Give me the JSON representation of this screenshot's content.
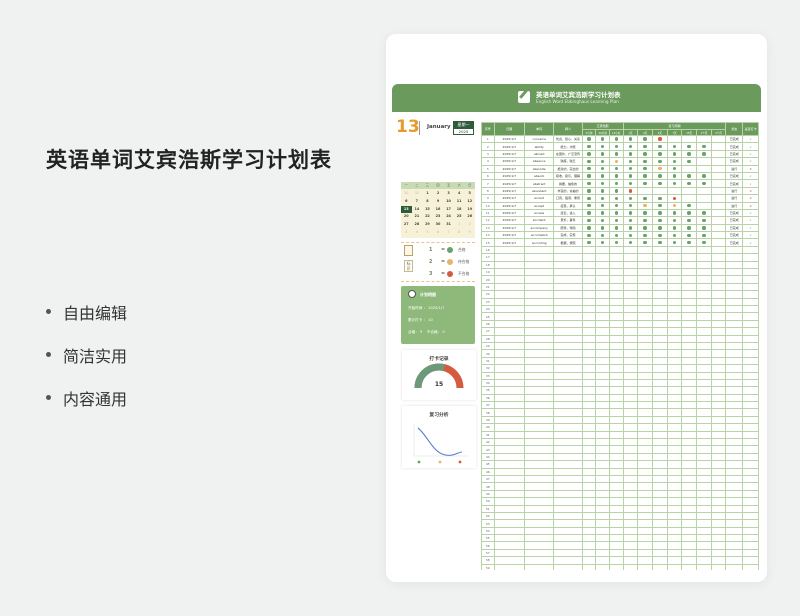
{
  "headline": "英语单词艾宾浩斯学习计划表",
  "features": [
    "自由编辑",
    "简洁实用",
    "内容通用"
  ],
  "colors": {
    "green": "#6aa26a",
    "orange": "#e8b36a",
    "red": "#d65a3e",
    "dark": "#2e5c3a"
  },
  "sheet": {
    "title": "英语单词艾宾浩斯学习计划表",
    "subtitle": "English Word Ebbinghaus Learning Plan",
    "date": {
      "day": "13",
      "month": "January",
      "weekday": "星期一",
      "year": "2025"
    },
    "calendar": {
      "weekdays": [
        "一",
        "二",
        "三",
        "四",
        "五",
        "六",
        "日"
      ],
      "days": [
        "30",
        "31",
        "1",
        "2",
        "3",
        "4",
        "5",
        "6",
        "7",
        "8",
        "9",
        "10",
        "11",
        "12",
        "13",
        "14",
        "15",
        "16",
        "17",
        "18",
        "19",
        "20",
        "21",
        "22",
        "23",
        "24",
        "25",
        "26",
        "27",
        "28",
        "29",
        "30",
        "31",
        "1",
        "2",
        "3",
        "4",
        "5",
        "6",
        "7",
        "8",
        "9"
      ],
      "today_index": 14
    },
    "legend": {
      "tag": "标识",
      "items": [
        {
          "num": "1",
          "eq": "=",
          "color": "green",
          "label": "合格"
        },
        {
          "num": "2",
          "eq": "=",
          "color": "orange",
          "label": "待合格"
        },
        {
          "num": "3",
          "eq": "=",
          "color": "red",
          "label": "不合格"
        }
      ]
    },
    "plan": {
      "title": "计划明细",
      "start_label": "开始时间",
      "start_value": "2025/1/7",
      "count_label": "累计打卡",
      "count_value": "10",
      "good_label": "合格",
      "good_value": "9",
      "bad_label": "不合格",
      "bad_value": "0"
    },
    "checkin": {
      "title": "打卡记录",
      "value": "15",
      "progress": 0.58
    },
    "review": {
      "title": "复习分析"
    },
    "table": {
      "group_headers": [
        "艾宾浩斯",
        "复习周期"
      ],
      "headers": [
        "序号",
        "日期",
        "单词",
        "释义",
        "状态",
        "是否打卡"
      ],
      "sub_headers": [
        "5分钟",
        "30分钟",
        "12小时",
        "1天",
        "2天",
        "4天",
        "7天",
        "15天",
        "1个月",
        "3个月"
      ],
      "rows": [
        {
          "no": "1",
          "date": "2025/1/7",
          "word": "concerns",
          "meaning": "忧虑，担心，关系",
          "marks": [
            1,
            1,
            1,
            1,
            1,
            3,
            0,
            0,
            0,
            0
          ],
          "status": "已完成",
          "done": "✓"
        },
        {
          "no": "2",
          "date": "2025/1/7",
          "word": "ability",
          "meaning": "能力，才能",
          "marks": [
            1,
            1,
            1,
            1,
            1,
            1,
            1,
            1,
            1,
            0
          ],
          "status": "已完成",
          "done": "✓"
        },
        {
          "no": "3",
          "date": "2025/1/7",
          "word": "abroad",
          "meaning": "在国外，广泛流传",
          "marks": [
            1,
            1,
            1,
            1,
            1,
            1,
            1,
            1,
            1,
            0
          ],
          "status": "已完成",
          "done": "✓"
        },
        {
          "no": "4",
          "date": "2025/1/7",
          "word": "absence",
          "meaning": "缺席，缺乏",
          "marks": [
            1,
            1,
            2,
            1,
            1,
            1,
            1,
            1,
            0,
            0
          ],
          "status": "已完成",
          "done": "✓"
        },
        {
          "no": "5",
          "date": "2025/1/7",
          "word": "absolute",
          "meaning": "绝对的，完全的",
          "marks": [
            1,
            1,
            1,
            1,
            1,
            2,
            1,
            0,
            0,
            0
          ],
          "status": "进行",
          "done": "X"
        },
        {
          "no": "6",
          "date": "2025/1/7",
          "word": "absorb",
          "meaning": "吸收，吸引，理解",
          "marks": [
            1,
            1,
            1,
            1,
            1,
            1,
            1,
            1,
            1,
            0
          ],
          "status": "已完成",
          "done": "✓"
        },
        {
          "no": "7",
          "date": "2025/1/7",
          "word": "abstract",
          "meaning": "摘要，抽象的",
          "marks": [
            1,
            1,
            1,
            1,
            1,
            1,
            1,
            1,
            1,
            0
          ],
          "status": "已完成",
          "done": "✓"
        },
        {
          "no": "8",
          "date": "2025/1/7",
          "word": "abundant",
          "meaning": "丰富的，充裕的",
          "marks": [
            1,
            1,
            1,
            3,
            0,
            0,
            0,
            0,
            0,
            0
          ],
          "status": "进行",
          "done": "X"
        },
        {
          "no": "9",
          "date": "2025/1/7",
          "word": "accent",
          "meaning": "口音，强调，重音",
          "marks": [
            1,
            1,
            1,
            1,
            1,
            1,
            3,
            0,
            0,
            0
          ],
          "status": "进行",
          "done": "X"
        },
        {
          "no": "10",
          "date": "2025/1/7",
          "word": "accept",
          "meaning": "接受，承认",
          "marks": [
            1,
            1,
            1,
            1,
            2,
            1,
            2,
            1,
            0,
            0
          ],
          "status": "进行",
          "done": "X"
        },
        {
          "no": "11",
          "date": "2025/1/7",
          "word": "access",
          "meaning": "接近，进入",
          "marks": [
            1,
            1,
            1,
            1,
            1,
            1,
            1,
            1,
            1,
            0
          ],
          "status": "已完成",
          "done": "✓"
        },
        {
          "no": "12",
          "date": "2025/1/7",
          "word": "accident",
          "meaning": "意外，事件",
          "marks": [
            1,
            1,
            1,
            1,
            1,
            1,
            1,
            1,
            1,
            0
          ],
          "status": "已完成",
          "done": "✓"
        },
        {
          "no": "13",
          "date": "2025/1/7",
          "word": "accompany",
          "meaning": "陪伴，伴随",
          "marks": [
            1,
            1,
            1,
            1,
            1,
            1,
            1,
            1,
            1,
            0
          ],
          "status": "已完成",
          "done": "✓"
        },
        {
          "no": "14",
          "date": "2025/1/7",
          "word": "accomplish",
          "meaning": "完成，实现",
          "marks": [
            1,
            1,
            1,
            1,
            1,
            1,
            1,
            1,
            1,
            0
          ],
          "status": "已完成",
          "done": "✓"
        },
        {
          "no": "15",
          "date": "2025/1/7",
          "word": "according",
          "meaning": "根据，按照",
          "marks": [
            1,
            1,
            1,
            1,
            1,
            1,
            1,
            1,
            1,
            0
          ],
          "status": "已完成",
          "done": "✓"
        }
      ],
      "empty_row_numbers": [
        "16",
        "17",
        "18",
        "19",
        "20",
        "21",
        "22",
        "23",
        "24",
        "25",
        "26",
        "27",
        "28",
        "29",
        "30",
        "31",
        "32",
        "33",
        "34",
        "35",
        "36",
        "37",
        "38",
        "39",
        "40",
        "41",
        "42",
        "43",
        "44",
        "45",
        "46",
        "47",
        "48",
        "49",
        "50",
        "51",
        "52",
        "53",
        "54",
        "55",
        "56",
        "57",
        "58",
        "59",
        "60"
      ]
    }
  }
}
